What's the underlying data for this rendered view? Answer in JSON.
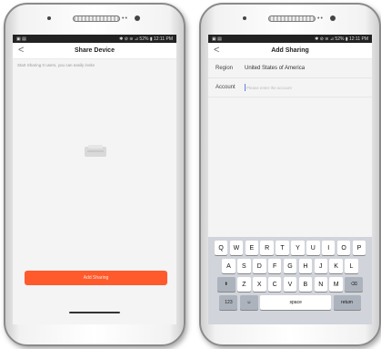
{
  "left_phone": {
    "status": {
      "left": "▣ ▤",
      "right": "✱ ⊘ ≋ ⊿ 52% ▮ 12:11 PM"
    },
    "nav": {
      "back": "<",
      "title": "Share Device"
    },
    "hint": "Start Sharing 0 users, you can easily invite",
    "button": "Add Sharing"
  },
  "right_phone": {
    "status": {
      "left": "▣ ▤",
      "right": "✱ ⊘ ≋ ⊿ 52% ▮ 12:11 PM"
    },
    "nav": {
      "back": "<",
      "title": "Add Sharing"
    },
    "region": {
      "label": "Region",
      "value": "United States of America"
    },
    "account": {
      "label": "Account",
      "placeholder": "Please enter the account"
    },
    "keyboard": {
      "row1": [
        "Q",
        "W",
        "E",
        "R",
        "T",
        "Y",
        "U",
        "I",
        "O",
        "P"
      ],
      "row2": [
        "A",
        "S",
        "D",
        "F",
        "G",
        "H",
        "J",
        "K",
        "L"
      ],
      "row3": [
        "Z",
        "X",
        "C",
        "V",
        "B",
        "N",
        "M"
      ],
      "shift": "⬆",
      "delete": "⌫",
      "numbers": "123",
      "emoji": "☺",
      "space": "space",
      "return": "return"
    }
  }
}
